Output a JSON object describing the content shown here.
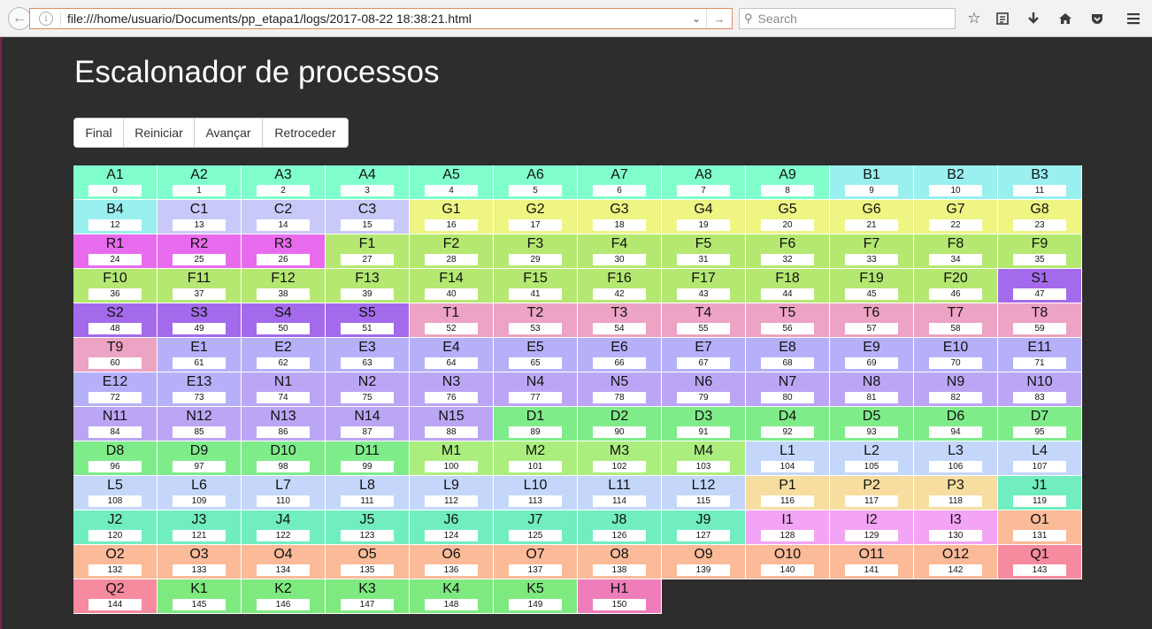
{
  "browser": {
    "url": "file:///home/usuario/Documents/pp_etapa1/logs/2017-08-22 18:38:21.html",
    "search_placeholder": "Search"
  },
  "page": {
    "title": "Escalonador de processos",
    "buttons": [
      "Final",
      "Reiniciar",
      "Avançar",
      "Retroceder"
    ]
  },
  "colors": {
    "A": "#80fecc",
    "B": "#9aefef",
    "C": "#c9c9f9",
    "G": "#eef582",
    "R": "#e86bee",
    "F": "#b4e871",
    "S": "#a46aec",
    "T": "#eda3c3",
    "E": "#b6b0f9",
    "N": "#bba6f5",
    "D": "#7fec8a",
    "M": "#acee7e",
    "L": "#c4d7fb",
    "P": "#f8dda0",
    "J": "#70eebf",
    "I": "#f3a4f4",
    "O": "#fbba98",
    "Q": "#f68a9f",
    "K": "#7ee97f",
    "H": "#ef7dba"
  },
  "processes": [
    {
      "label": "A1",
      "num": "0"
    },
    {
      "label": "A2",
      "num": "1"
    },
    {
      "label": "A3",
      "num": "2"
    },
    {
      "label": "A4",
      "num": "3"
    },
    {
      "label": "A5",
      "num": "4"
    },
    {
      "label": "A6",
      "num": "5"
    },
    {
      "label": "A7",
      "num": "6"
    },
    {
      "label": "A8",
      "num": "7"
    },
    {
      "label": "A9",
      "num": "8"
    },
    {
      "label": "B1",
      "num": "9"
    },
    {
      "label": "B2",
      "num": "10"
    },
    {
      "label": "B3",
      "num": "11"
    },
    {
      "label": "B4",
      "num": "12"
    },
    {
      "label": "C1",
      "num": "13"
    },
    {
      "label": "C2",
      "num": "14"
    },
    {
      "label": "C3",
      "num": "15"
    },
    {
      "label": "G1",
      "num": "16"
    },
    {
      "label": "G2",
      "num": "17"
    },
    {
      "label": "G3",
      "num": "18"
    },
    {
      "label": "G4",
      "num": "19"
    },
    {
      "label": "G5",
      "num": "20"
    },
    {
      "label": "G6",
      "num": "21"
    },
    {
      "label": "G7",
      "num": "22"
    },
    {
      "label": "G8",
      "num": "23"
    },
    {
      "label": "R1",
      "num": "24"
    },
    {
      "label": "R2",
      "num": "25"
    },
    {
      "label": "R3",
      "num": "26"
    },
    {
      "label": "F1",
      "num": "27"
    },
    {
      "label": "F2",
      "num": "28"
    },
    {
      "label": "F3",
      "num": "29"
    },
    {
      "label": "F4",
      "num": "30"
    },
    {
      "label": "F5",
      "num": "31"
    },
    {
      "label": "F6",
      "num": "32"
    },
    {
      "label": "F7",
      "num": "33"
    },
    {
      "label": "F8",
      "num": "34"
    },
    {
      "label": "F9",
      "num": "35"
    },
    {
      "label": "F10",
      "num": "36"
    },
    {
      "label": "F11",
      "num": "37"
    },
    {
      "label": "F12",
      "num": "38"
    },
    {
      "label": "F13",
      "num": "39"
    },
    {
      "label": "F14",
      "num": "40"
    },
    {
      "label": "F15",
      "num": "41"
    },
    {
      "label": "F16",
      "num": "42"
    },
    {
      "label": "F17",
      "num": "43"
    },
    {
      "label": "F18",
      "num": "44"
    },
    {
      "label": "F19",
      "num": "45"
    },
    {
      "label": "F20",
      "num": "46"
    },
    {
      "label": "S1",
      "num": "47"
    },
    {
      "label": "S2",
      "num": "48"
    },
    {
      "label": "S3",
      "num": "49"
    },
    {
      "label": "S4",
      "num": "50"
    },
    {
      "label": "S5",
      "num": "51"
    },
    {
      "label": "T1",
      "num": "52"
    },
    {
      "label": "T2",
      "num": "53"
    },
    {
      "label": "T3",
      "num": "54"
    },
    {
      "label": "T4",
      "num": "55"
    },
    {
      "label": "T5",
      "num": "56"
    },
    {
      "label": "T6",
      "num": "57"
    },
    {
      "label": "T7",
      "num": "58"
    },
    {
      "label": "T8",
      "num": "59"
    },
    {
      "label": "T9",
      "num": "60"
    },
    {
      "label": "E1",
      "num": "61"
    },
    {
      "label": "E2",
      "num": "62"
    },
    {
      "label": "E3",
      "num": "63"
    },
    {
      "label": "E4",
      "num": "64"
    },
    {
      "label": "E5",
      "num": "65"
    },
    {
      "label": "E6",
      "num": "66"
    },
    {
      "label": "E7",
      "num": "67"
    },
    {
      "label": "E8",
      "num": "68"
    },
    {
      "label": "E9",
      "num": "69"
    },
    {
      "label": "E10",
      "num": "70"
    },
    {
      "label": "E11",
      "num": "71"
    },
    {
      "label": "E12",
      "num": "72"
    },
    {
      "label": "E13",
      "num": "73"
    },
    {
      "label": "N1",
      "num": "74"
    },
    {
      "label": "N2",
      "num": "75"
    },
    {
      "label": "N3",
      "num": "76"
    },
    {
      "label": "N4",
      "num": "77"
    },
    {
      "label": "N5",
      "num": "78"
    },
    {
      "label": "N6",
      "num": "79"
    },
    {
      "label": "N7",
      "num": "80"
    },
    {
      "label": "N8",
      "num": "81"
    },
    {
      "label": "N9",
      "num": "82"
    },
    {
      "label": "N10",
      "num": "83"
    },
    {
      "label": "N11",
      "num": "84"
    },
    {
      "label": "N12",
      "num": "85"
    },
    {
      "label": "N13",
      "num": "86"
    },
    {
      "label": "N14",
      "num": "87"
    },
    {
      "label": "N15",
      "num": "88"
    },
    {
      "label": "D1",
      "num": "89"
    },
    {
      "label": "D2",
      "num": "90"
    },
    {
      "label": "D3",
      "num": "91"
    },
    {
      "label": "D4",
      "num": "92"
    },
    {
      "label": "D5",
      "num": "93"
    },
    {
      "label": "D6",
      "num": "94"
    },
    {
      "label": "D7",
      "num": "95"
    },
    {
      "label": "D8",
      "num": "96"
    },
    {
      "label": "D9",
      "num": "97"
    },
    {
      "label": "D10",
      "num": "98"
    },
    {
      "label": "D11",
      "num": "99"
    },
    {
      "label": "M1",
      "num": "100"
    },
    {
      "label": "M2",
      "num": "101"
    },
    {
      "label": "M3",
      "num": "102"
    },
    {
      "label": "M4",
      "num": "103"
    },
    {
      "label": "L1",
      "num": "104"
    },
    {
      "label": "L2",
      "num": "105"
    },
    {
      "label": "L3",
      "num": "106"
    },
    {
      "label": "L4",
      "num": "107"
    },
    {
      "label": "L5",
      "num": "108"
    },
    {
      "label": "L6",
      "num": "109"
    },
    {
      "label": "L7",
      "num": "110"
    },
    {
      "label": "L8",
      "num": "111"
    },
    {
      "label": "L9",
      "num": "112"
    },
    {
      "label": "L10",
      "num": "113"
    },
    {
      "label": "L11",
      "num": "114"
    },
    {
      "label": "L12",
      "num": "115"
    },
    {
      "label": "P1",
      "num": "116"
    },
    {
      "label": "P2",
      "num": "117"
    },
    {
      "label": "P3",
      "num": "118"
    },
    {
      "label": "J1",
      "num": "119"
    },
    {
      "label": "J2",
      "num": "120"
    },
    {
      "label": "J3",
      "num": "121"
    },
    {
      "label": "J4",
      "num": "122"
    },
    {
      "label": "J5",
      "num": "123"
    },
    {
      "label": "J6",
      "num": "124"
    },
    {
      "label": "J7",
      "num": "125"
    },
    {
      "label": "J8",
      "num": "126"
    },
    {
      "label": "J9",
      "num": "127"
    },
    {
      "label": "I1",
      "num": "128"
    },
    {
      "label": "I2",
      "num": "129"
    },
    {
      "label": "I3",
      "num": "130"
    },
    {
      "label": "O1",
      "num": "131"
    },
    {
      "label": "O2",
      "num": "132"
    },
    {
      "label": "O3",
      "num": "133"
    },
    {
      "label": "O4",
      "num": "134"
    },
    {
      "label": "O5",
      "num": "135"
    },
    {
      "label": "O6",
      "num": "136"
    },
    {
      "label": "O7",
      "num": "137"
    },
    {
      "label": "O8",
      "num": "138"
    },
    {
      "label": "O9",
      "num": "139"
    },
    {
      "label": "O10",
      "num": "140"
    },
    {
      "label": "O11",
      "num": "141"
    },
    {
      "label": "O12",
      "num": "142"
    },
    {
      "label": "Q1",
      "num": "143"
    },
    {
      "label": "Q2",
      "num": "144"
    },
    {
      "label": "K1",
      "num": "145"
    },
    {
      "label": "K2",
      "num": "146"
    },
    {
      "label": "K3",
      "num": "147"
    },
    {
      "label": "K4",
      "num": "148"
    },
    {
      "label": "K5",
      "num": "149"
    },
    {
      "label": "H1",
      "num": "150"
    }
  ]
}
